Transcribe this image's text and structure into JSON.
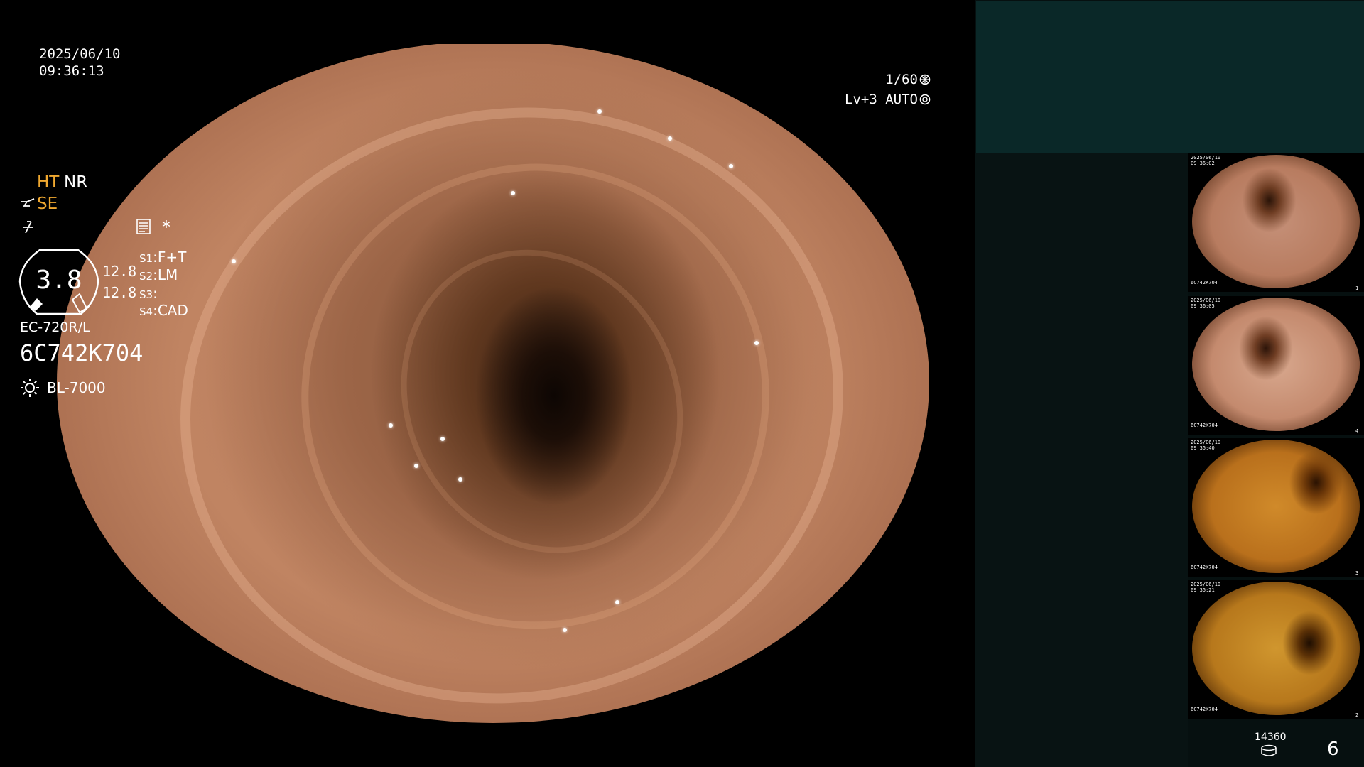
{
  "overlay": {
    "date": "2025/06/10",
    "time": "09:36:13",
    "shutter": "1/60",
    "level": "Lv+3",
    "mode": "AUTO"
  },
  "settings": {
    "ht": "HT",
    "nr": "NR",
    "se": "SE",
    "star": "*",
    "gauge_value": "3.8",
    "value_a": "12.8",
    "value_b": "12.8",
    "switches": [
      {
        "key": "S1",
        "value": "F+T"
      },
      {
        "key": "S2",
        "value": "LM"
      },
      {
        "key": "S3",
        "value": ""
      },
      {
        "key": "S4",
        "value": "CAD"
      }
    ]
  },
  "scope": {
    "model": "EC-720R/L",
    "serial": "6C742K704",
    "light_source": "BL-7000"
  },
  "thumbnails": [
    {
      "date": "2025/06/10",
      "time": "09:36:02",
      "serial": "6C742K704",
      "index": "1"
    },
    {
      "date": "2025/06/10",
      "time": "09:36:05",
      "serial": "6C742K704",
      "index": "4"
    },
    {
      "date": "2025/06/10",
      "time": "09:35:40",
      "serial": "6C742K704",
      "index": "3"
    },
    {
      "date": "2025/06/10",
      "time": "09:35:21",
      "serial": "6C742K704",
      "index": "2"
    }
  ],
  "footer": {
    "counter": "14360",
    "page_number": "6"
  },
  "colors": {
    "accent_orange": "#f0a830",
    "panel_header": "#0a2828",
    "panel_background": "#061010"
  },
  "icons": {
    "shutter_icon": "aperture-icon",
    "mode_icon": "auto-iris-icon",
    "se_icon": "structure-enhance-icon",
    "f_icon": "freeze-icon",
    "menu_icon": "menu-list-icon",
    "lamp_icon": "light-source-icon",
    "disk_icon": "storage-disk-icon"
  }
}
